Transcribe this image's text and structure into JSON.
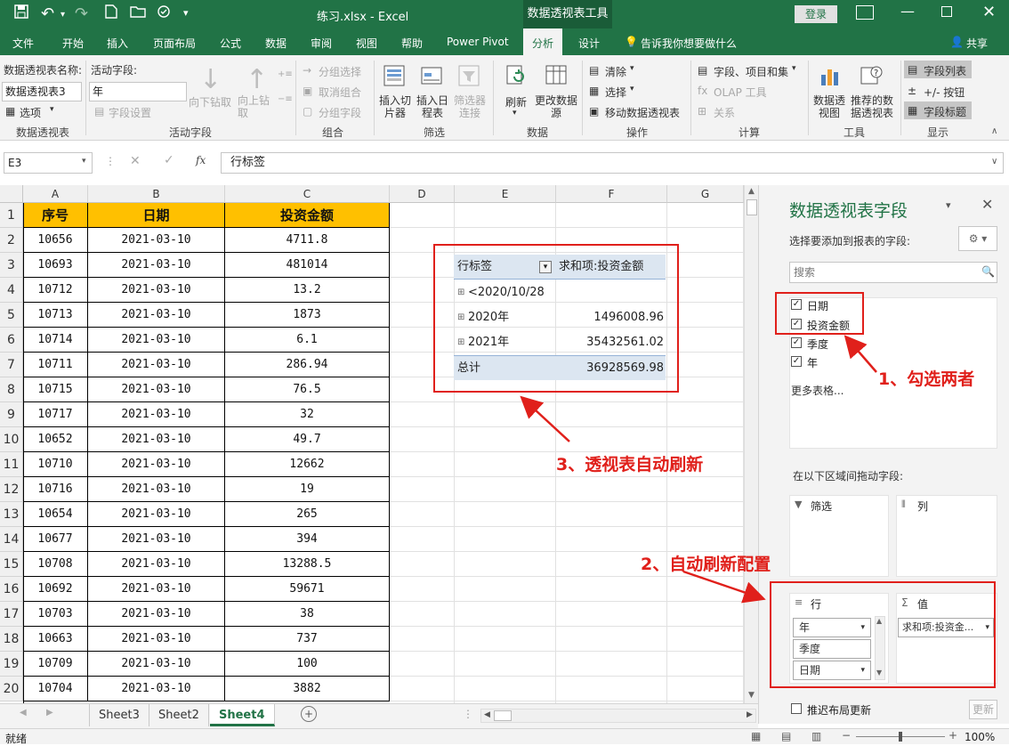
{
  "window": {
    "file_title": "练习.xlsx  -  Excel",
    "context_title": "数据透视表工具",
    "login": "登录"
  },
  "ribbon_tabs": [
    "文件",
    "开始",
    "插入",
    "页面布局",
    "公式",
    "数据",
    "审阅",
    "视图",
    "帮助",
    "Power Pivot",
    "分析",
    "设计"
  ],
  "tell_me": "告诉我你想要做什么",
  "share": "共享",
  "ribbon": {
    "pivot_name_label": "数据透视表名称:",
    "pivot_name_value": "数据透视表3",
    "options": "选项",
    "group_pivot": "数据透视表",
    "active_field_label": "活动字段:",
    "active_field_value": "年",
    "field_settings": "字段设置",
    "drill_down": "向下钻取",
    "drill_up": "向上钻取",
    "group_active": "活动字段",
    "group_selection": "分组选择",
    "ungroup": "取消组合",
    "group_field": "分组字段",
    "group_group": "组合",
    "insert_slicer": "插入切片器",
    "insert_timeline": "插入日程表",
    "filter_connections": "筛选器连接",
    "group_filter": "筛选",
    "refresh": "刷新",
    "change_source": "更改数据源",
    "group_data": "数据",
    "clear": "清除",
    "select": "选择",
    "move_pivot": "移动数据透视表",
    "group_actions": "操作",
    "fields_items": "字段、项目和集",
    "olap": "OLAP 工具",
    "relationships": "关系",
    "group_calc": "计算",
    "pivot_chart": "数据透视图",
    "recommended": "推荐的数据透视表",
    "group_tools": "工具",
    "field_list": "字段列表",
    "buttons": "+/- 按钮",
    "field_headers": "字段标题",
    "group_show": "显示"
  },
  "formula_bar": {
    "name_box": "E3",
    "fx": "fx",
    "content": "行标签"
  },
  "columns": [
    "A",
    "B",
    "C",
    "D",
    "E",
    "F",
    "G"
  ],
  "rows": [
    "1",
    "2",
    "3",
    "4",
    "5",
    "6",
    "7",
    "8",
    "9",
    "10",
    "11",
    "12",
    "13",
    "14",
    "15",
    "16",
    "17",
    "18",
    "19",
    "20"
  ],
  "table": {
    "headers": [
      "序号",
      "日期",
      "投资金额"
    ],
    "data": [
      [
        "10656",
        "2021-03-10",
        "4711.8"
      ],
      [
        "10693",
        "2021-03-10",
        "481014"
      ],
      [
        "10712",
        "2021-03-10",
        "13.2"
      ],
      [
        "10713",
        "2021-03-10",
        "1873"
      ],
      [
        "10714",
        "2021-03-10",
        "6.1"
      ],
      [
        "10711",
        "2021-03-10",
        "286.94"
      ],
      [
        "10715",
        "2021-03-10",
        "76.5"
      ],
      [
        "10717",
        "2021-03-10",
        "32"
      ],
      [
        "10652",
        "2021-03-10",
        "49.7"
      ],
      [
        "10710",
        "2021-03-10",
        "12662"
      ],
      [
        "10716",
        "2021-03-10",
        "19"
      ],
      [
        "10654",
        "2021-03-10",
        "265"
      ],
      [
        "10677",
        "2021-03-10",
        "394"
      ],
      [
        "10708",
        "2021-03-10",
        "13288.5"
      ],
      [
        "10692",
        "2021-03-10",
        "59671"
      ],
      [
        "10703",
        "2021-03-10",
        "38"
      ],
      [
        "10663",
        "2021-03-10",
        "737"
      ],
      [
        "10709",
        "2021-03-10",
        "100"
      ],
      [
        "10704",
        "2021-03-10",
        "3882"
      ]
    ]
  },
  "pivot": {
    "row_label": "行标签",
    "value_header": "求和项:投资金额",
    "rows": [
      {
        "label": "<2020/10/28",
        "value": ""
      },
      {
        "label": "2020年",
        "value": "1496008.96"
      },
      {
        "label": "2021年",
        "value": "35432561.02"
      }
    ],
    "total_label": "总计",
    "total_value": "36928569.98"
  },
  "annotations": {
    "a1": "1、勾选两者",
    "a2": "2、自动刷新配置",
    "a3": "3、透视表自动刷新"
  },
  "field_panel": {
    "title": "数据透视表字段",
    "choose_label": "选择要添加到报表的字段:",
    "search_placeholder": "搜索",
    "fields": [
      "日期",
      "投资金额",
      "季度",
      "年"
    ],
    "more_tables": "更多表格...",
    "drag_label": "在以下区域间拖动字段:",
    "filters": "筛选",
    "columns": "列",
    "rows": "行",
    "values": "值",
    "row_items": [
      "年",
      "季度",
      "日期"
    ],
    "value_items": [
      "求和项:投资金..."
    ],
    "defer": "推迟布局更新",
    "update": "更新"
  },
  "sheet_tabs": [
    "Sheet3",
    "Sheet2",
    "Sheet4"
  ],
  "status": {
    "ready": "就绪",
    "zoom": "100%"
  },
  "colors": {
    "excel_green": "#217346",
    "header_fill": "#ffc000",
    "annotation_red": "#e0201b",
    "pivot_header_fill": "#dce6f1"
  }
}
